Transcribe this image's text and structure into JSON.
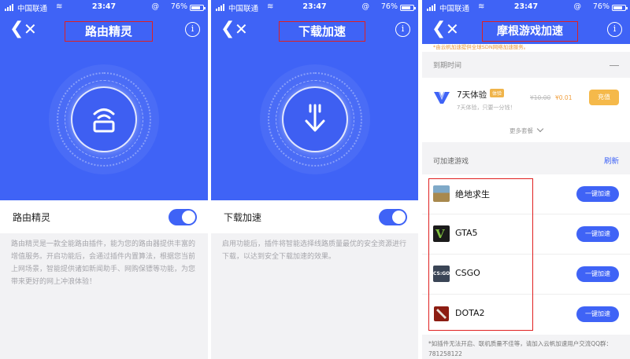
{
  "status_bar": {
    "carrier": "中国联通",
    "time": "23:47",
    "battery": "76%"
  },
  "colors": {
    "accent": "#3f63f6",
    "highlight_box": "#e02020",
    "price_orange": "#f0a040"
  },
  "icons": {
    "back": "chevron-left-icon",
    "close": "close-icon",
    "info": "info-icon",
    "router": "router-icon",
    "download": "download-icon"
  },
  "panels": [
    {
      "title": "路由精灵",
      "toggle_label": "路由精灵",
      "toggle_on": true,
      "description": "路由精灵是一款全能路由插件，能为您的路由器提供丰富的增值服务。开启功能后，会通过插件内置算法，根据您当前上网场景，智能提供诸如新闻助手、网购保镖等功能，为您带来更好的网上冲浪体验！"
    },
    {
      "title": "下载加速",
      "toggle_label": "下载加速",
      "toggle_on": true,
      "description": "启用功能后，插件将智能选择线路质量最优的安全资源进行下载，以达到安全下载加速的效果。"
    },
    {
      "title": "摩根游戏加速",
      "notice": "*由云帆加速提供全球SDN网络加速服务。",
      "expire_label": "到期时间",
      "plan": {
        "name": "7天体验",
        "tag": "体验",
        "subtitle": "7天体验，只要一分钱！",
        "old_price": "¥10.00",
        "new_price": "¥0.01",
        "button": "充值"
      },
      "more_plans": "更多套餐",
      "games_label": "可加速游戏",
      "refresh": "刷新",
      "games": [
        {
          "name": "绝地求生",
          "icon": "pubg-icon",
          "icon_text": "",
          "button": "一键加速",
          "icon_color": "#c9a86a"
        },
        {
          "name": "GTA5",
          "icon": "gta5-icon",
          "icon_text": "",
          "button": "一键加速",
          "icon_color": "#1b1b1b"
        },
        {
          "name": "CSGO",
          "icon": "csgo-icon",
          "icon_text": "CS:GO",
          "button": "一键加速",
          "icon_color": "#3a4556"
        },
        {
          "name": "DOTA2",
          "icon": "dota2-icon",
          "icon_text": "",
          "button": "一键加速",
          "icon_color": "#8c1d12"
        }
      ],
      "footnote": "*如插件无法开启、联机质量不佳等，请加入云帆加速用户交流QQ群：781258122"
    }
  ]
}
